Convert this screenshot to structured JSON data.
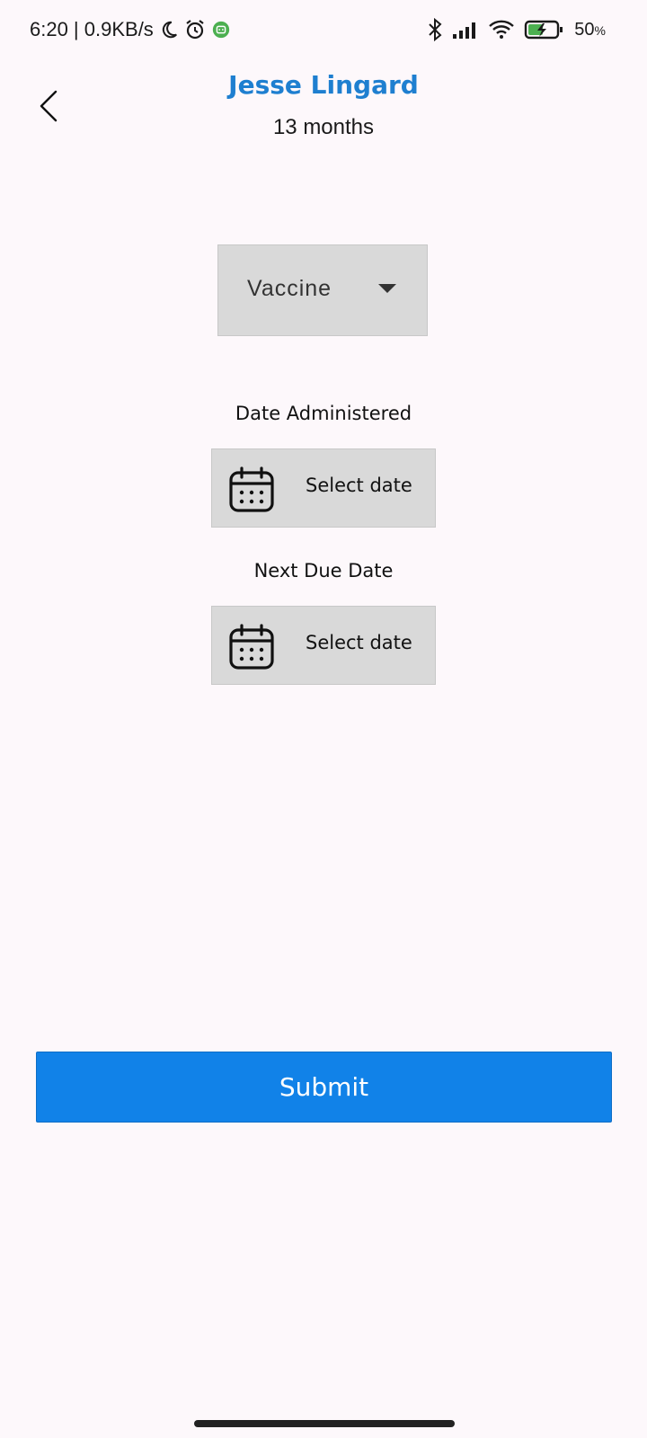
{
  "status_bar": {
    "time_speed": "6:20 | 0.9KB/s",
    "battery_percent": "50",
    "battery_unit": "%"
  },
  "header": {
    "child_name": "Jesse Lingard",
    "age": "13 months"
  },
  "form": {
    "vaccine_dropdown": {
      "selected_label": "Vaccine"
    },
    "date_administered": {
      "label": "Date Administered",
      "button_text": "Select date"
    },
    "next_due_date": {
      "label": "Next Due Date",
      "button_text": "Select date"
    },
    "submit_label": "Submit"
  },
  "colors": {
    "title": "#1e7fd0",
    "submit_bg": "#1182e8",
    "field_bg": "#d9d9d9",
    "page_bg": "#fdf8fb"
  },
  "icons": {
    "back": "chevron-left-icon",
    "calendar": "calendar-icon",
    "dropdown": "caret-down-icon"
  }
}
